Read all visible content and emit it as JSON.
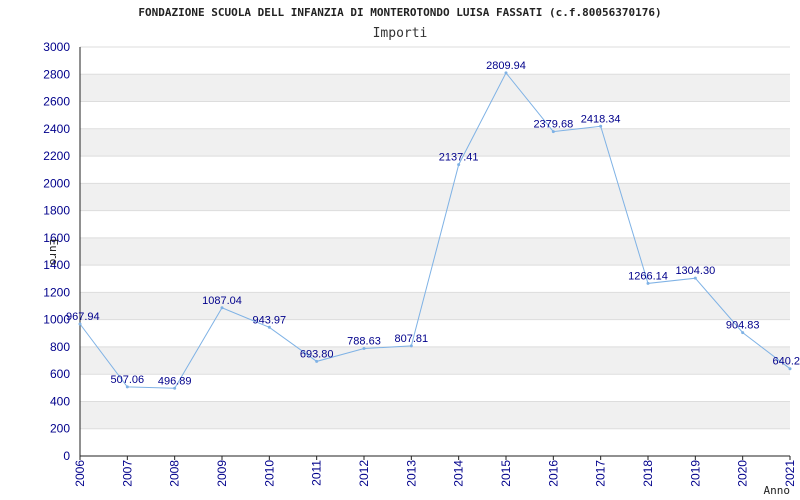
{
  "chart_data": {
    "type": "line",
    "title": "FONDAZIONE SCUOLA DELL INFANZIA DI MONTEROTONDO LUISA FASSATI (c.f.80056370176)",
    "subtitle": "Importi",
    "xlabel": "Anno",
    "ylabel": "Euro",
    "x": [
      "2006",
      "2007",
      "2008",
      "2009",
      "2010",
      "2011",
      "2012",
      "2013",
      "2014",
      "2015",
      "2016",
      "2017",
      "2018",
      "2019",
      "2020",
      "2021"
    ],
    "series": [
      {
        "values": [
          967.94,
          507.06,
          496.89,
          1087.04,
          943.97,
          693.8,
          788.63,
          807.81,
          2137.41,
          2809.94,
          2379.68,
          2418.34,
          1266.14,
          1304.3,
          904.83,
          640.2
        ],
        "data_labels": [
          "967.94",
          "507.06",
          "496.89",
          "1087.04",
          "943.97",
          "693.80",
          "788.63",
          "807.81",
          "2137.41",
          "2809.94",
          "2379.68",
          "2418.34",
          "1266.14",
          "1304.30",
          "904.83",
          "640.2"
        ]
      }
    ],
    "yticks": [
      "0",
      "200",
      "400",
      "600",
      "800",
      "1000",
      "1200",
      "1400",
      "1600",
      "1800",
      "2000",
      "2200",
      "2400",
      "2600",
      "2800",
      "3000"
    ],
    "ylim": [
      0,
      3000
    ],
    "grid": true,
    "line_color": "#7fb2e5",
    "band_color": "#f0f0f0",
    "text_color": "#00008b"
  }
}
